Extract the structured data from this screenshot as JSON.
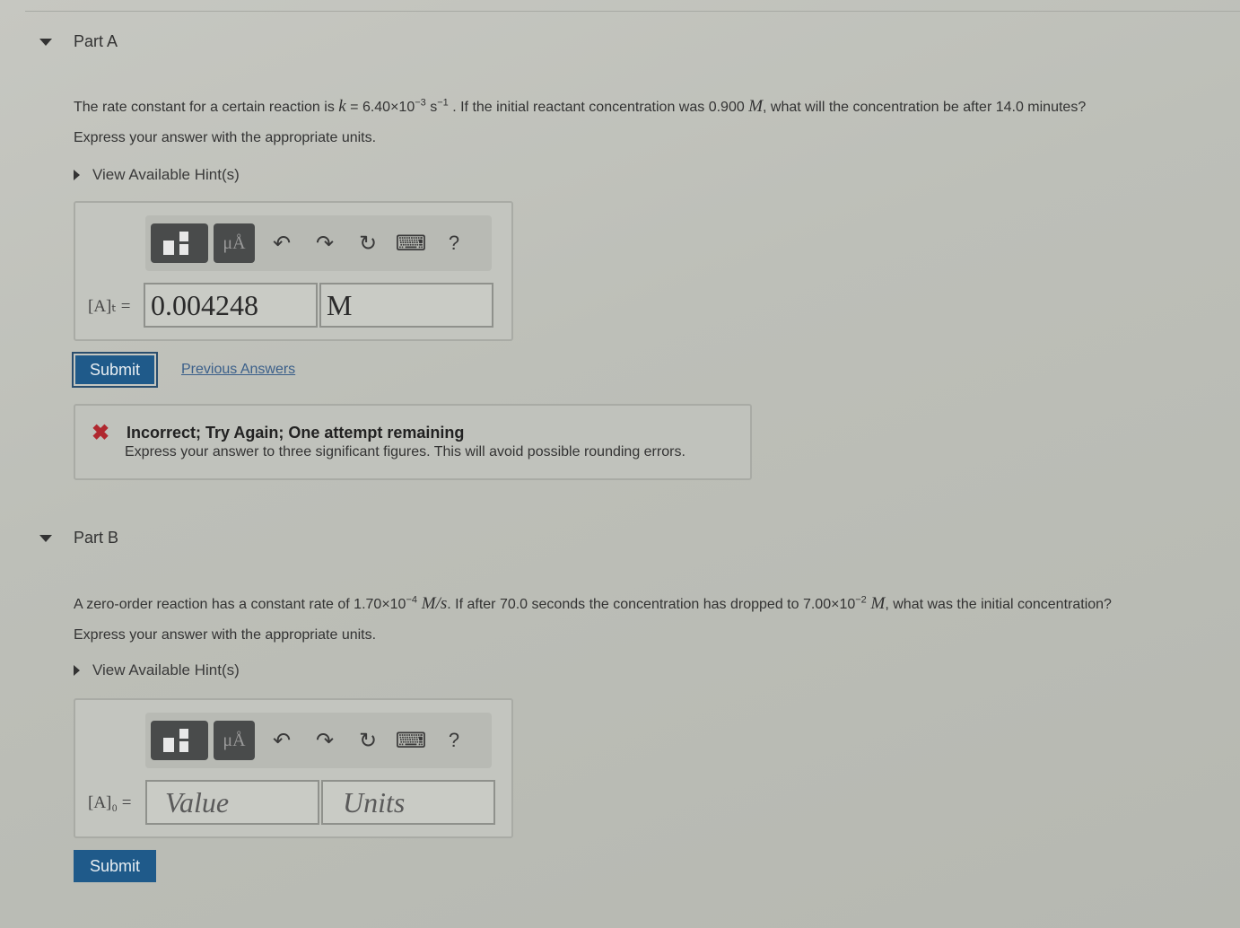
{
  "partA": {
    "title": "Part A",
    "question_pre": "The rate constant for a certain reaction is ",
    "k_symbol": "k",
    "k_value": " = 6.40×10",
    "k_exp": "−3",
    "k_unit": " s",
    "k_unit_exp": "−1",
    "question_mid": " . If the initial reactant concentration was 0.900 ",
    "molar": "M",
    "question_post": ", what will the concentration be after 14.0 minutes?",
    "instructions": "Express your answer with the appropriate units.",
    "hint_label": "View Available Hint(s)",
    "variable_label": "[A]ₜ =",
    "value": "0.004248",
    "units": "M",
    "submit_label": "Submit",
    "previous_answers_label": "Previous Answers",
    "feedback": {
      "title": "Incorrect; Try Again; One attempt remaining",
      "message": "Express your answer to three significant figures. This will avoid possible rounding errors."
    }
  },
  "partB": {
    "title": "Part B",
    "question_pre": "A zero-order reaction has a constant rate of 1.70×10",
    "rate_exp": "−4",
    "rate_unit": " M/s",
    "question_mid": ". If after 70.0 seconds the concentration has dropped to 7.00×10",
    "conc_exp": "−2",
    "molar": " M",
    "question_post": ", what was the initial concentration?",
    "instructions": "Express your answer with the appropriate units.",
    "hint_label": "View Available Hint(s)",
    "variable_label": "[A]₀ =",
    "value_placeholder": "Value",
    "units_placeholder": "Units",
    "submit_label": "Submit"
  },
  "toolbar": {
    "units_button_label": "μÅ",
    "help_label": "?",
    "icons": [
      "templates-icon",
      "units-icon",
      "undo-icon",
      "redo-icon",
      "reset-icon",
      "keyboard-icon",
      "help-icon"
    ]
  },
  "colors": {
    "submit_bg": "#1f5a8a",
    "error_red": "#b0282f",
    "link": "#3b5f8a"
  }
}
